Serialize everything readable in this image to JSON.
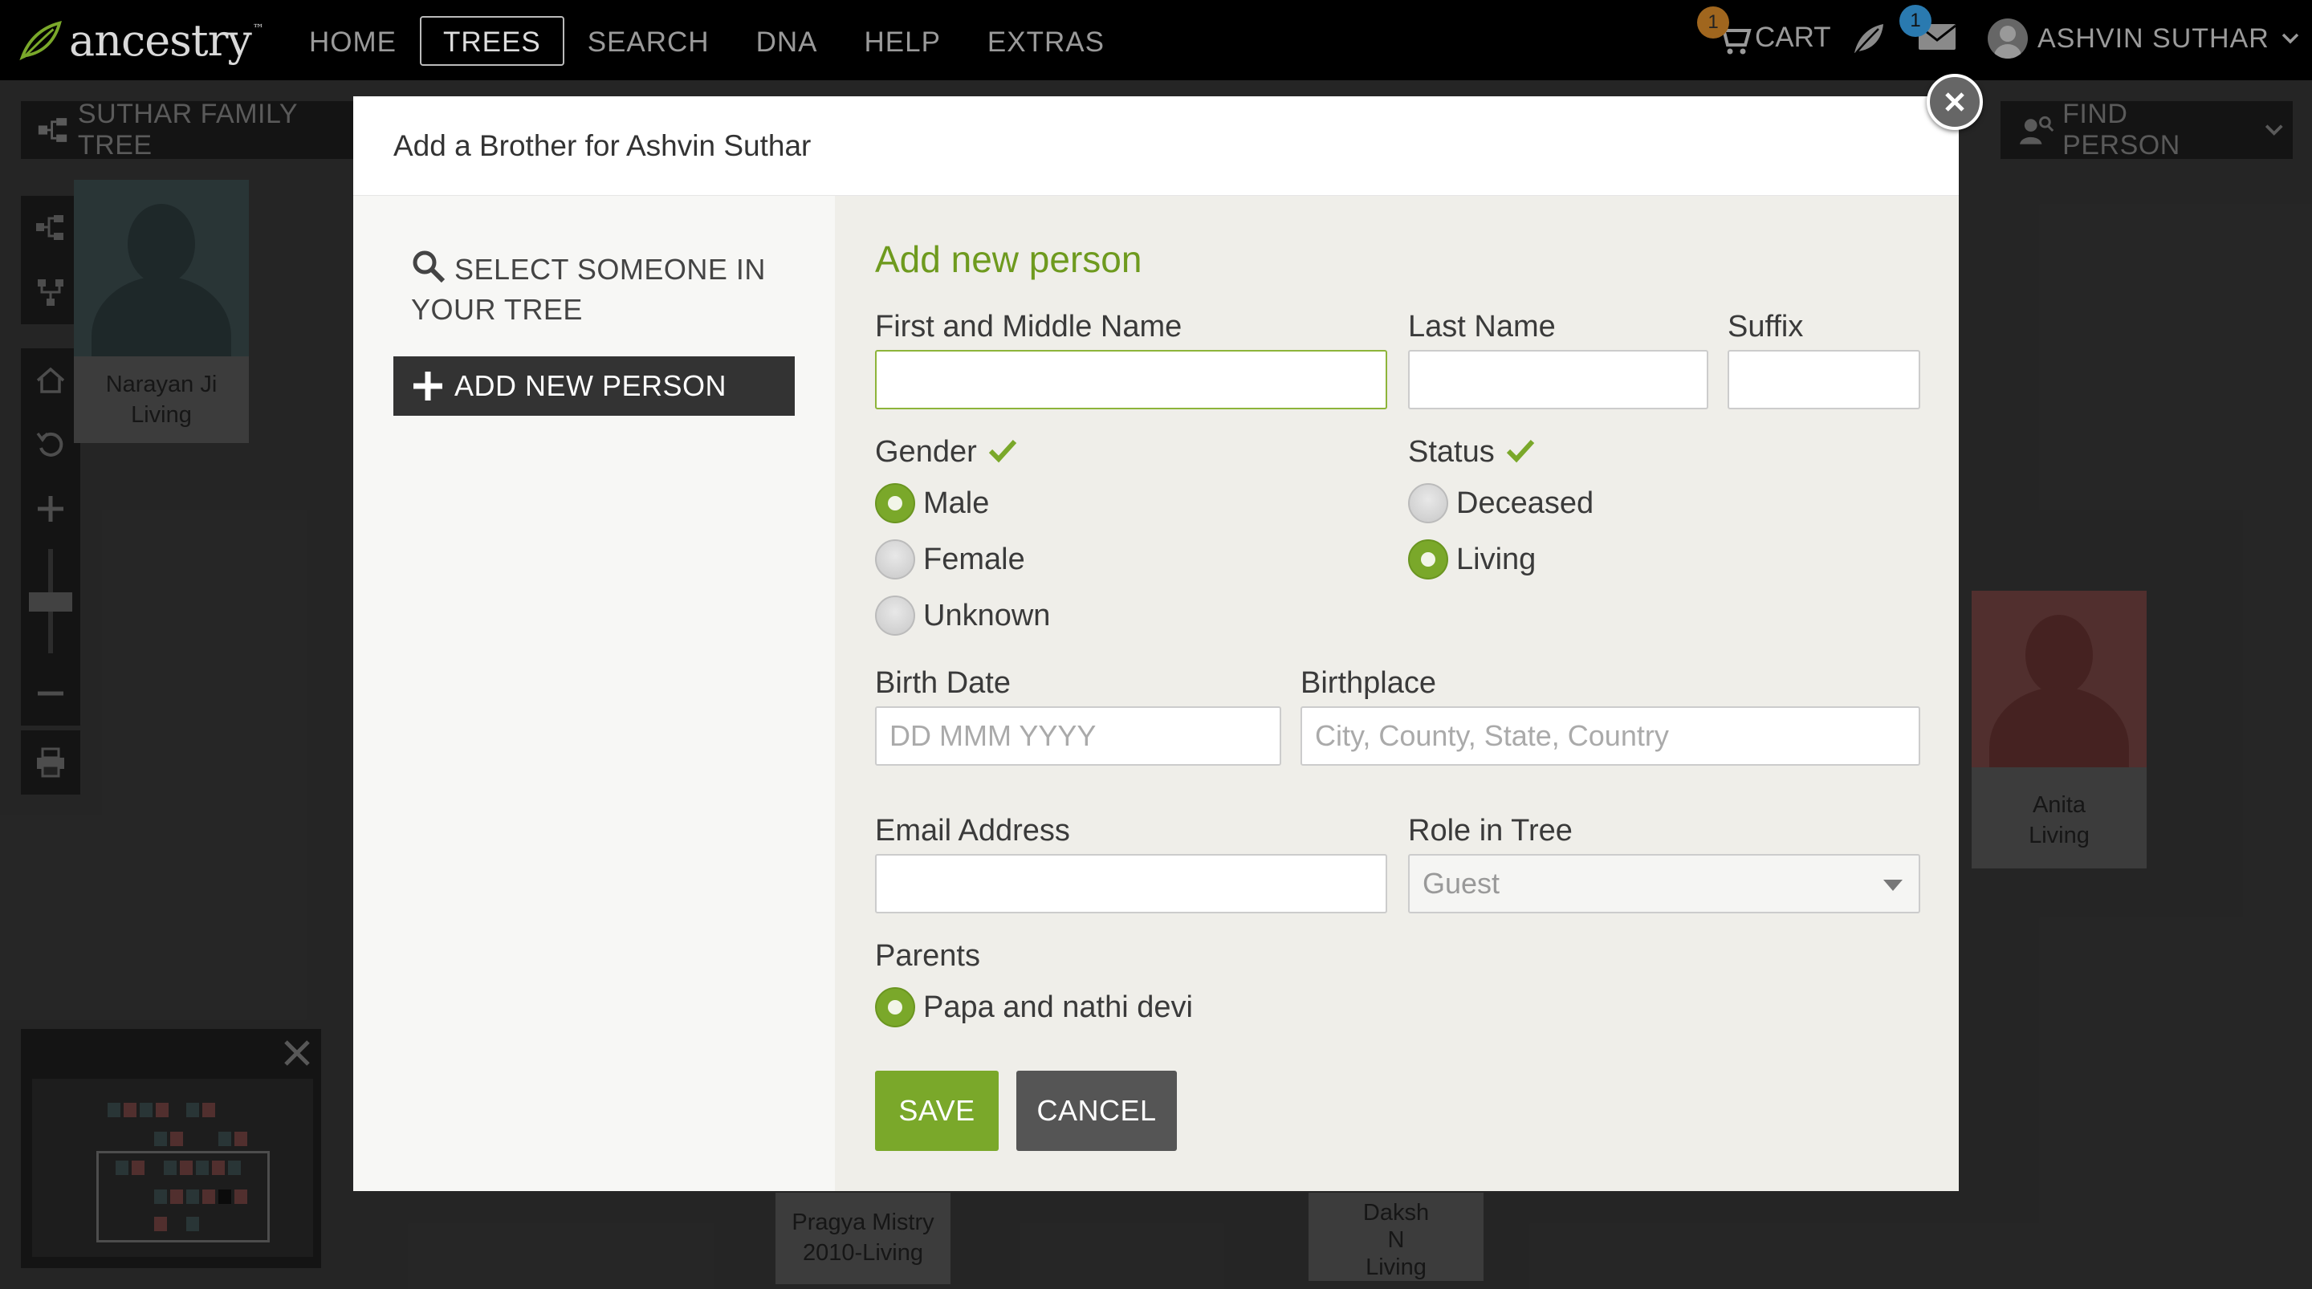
{
  "nav": {
    "logo": "ancestry",
    "links": [
      {
        "label": "HOME",
        "active": false
      },
      {
        "label": "TREES",
        "active": true
      },
      {
        "label": "SEARCH",
        "active": false
      },
      {
        "label": "DNA",
        "active": false
      },
      {
        "label": "HELP",
        "active": false
      },
      {
        "label": "EXTRAS",
        "active": false
      }
    ],
    "cart_label": "CART",
    "cart_count": "1",
    "messages_count": "1",
    "user_name": "ASHVIN SUTHAR"
  },
  "tree": {
    "name": "SUTHAR FAMILY TREE",
    "find_person": "FIND PERSON",
    "people": [
      {
        "name": "Narayan Ji",
        "dates": "Living"
      },
      {
        "name": "Anita",
        "dates": "Living"
      },
      {
        "name": "Pragya Mistry",
        "dates": "2010-Living"
      },
      {
        "name": "Daksh",
        "middle": "N",
        "dates": "Living"
      }
    ]
  },
  "modal": {
    "title": "Add a Brother for Ashvin Suthar",
    "select_someone": "SELECT SOMEONE IN YOUR TREE",
    "add_new_person_btn": "ADD NEW PERSON",
    "section_title": "Add new person",
    "first_middle_label": "First and Middle Name",
    "first_middle_value": "",
    "last_name_label": "Last Name",
    "last_name_value": "",
    "suffix_label": "Suffix",
    "suffix_value": "",
    "gender_label": "Gender",
    "gender_options": [
      "Male",
      "Female",
      "Unknown"
    ],
    "gender_selected": "Male",
    "status_label": "Status",
    "status_options": [
      "Deceased",
      "Living"
    ],
    "status_selected": "Living",
    "birth_date_label": "Birth Date",
    "birth_date_placeholder": "DD MMM YYYY",
    "birthplace_label": "Birthplace",
    "birthplace_placeholder": "City, County, State, Country",
    "email_label": "Email Address",
    "email_value": "",
    "role_label": "Role in Tree",
    "role_value": "Guest",
    "parents_label": "Parents",
    "parents_option": "Papa and nathi devi",
    "save": "SAVE",
    "cancel": "CANCEL"
  },
  "colors": {
    "accent_green": "#7aa82a",
    "title_green": "#6e9a1e",
    "cart_badge": "#a0661e",
    "mail_badge": "#2a7ab0"
  }
}
